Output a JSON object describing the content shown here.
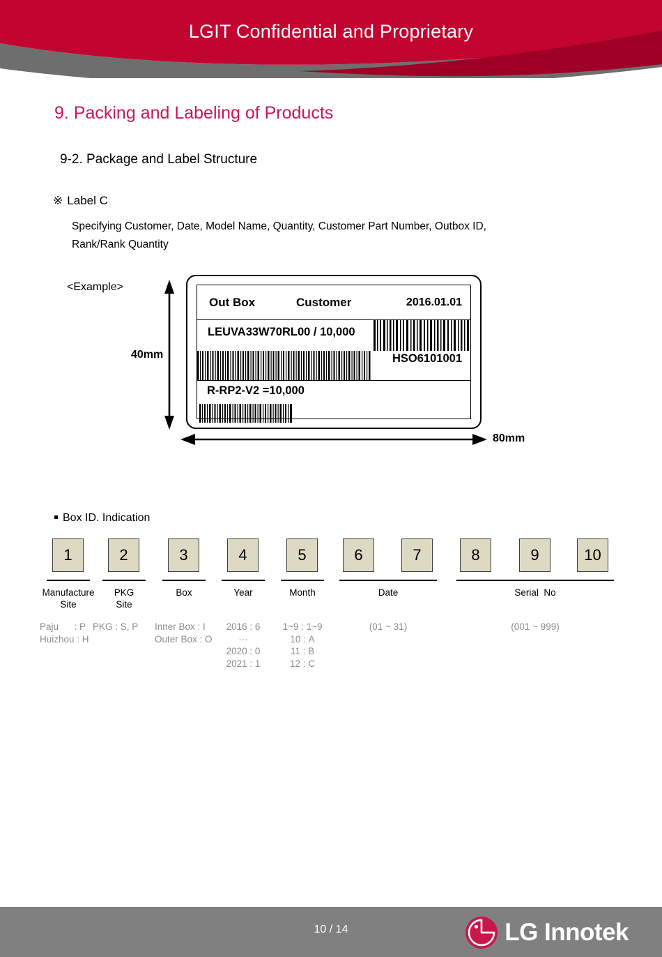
{
  "header": {
    "title": "LGIT Confidential and Proprietary",
    "band_color": "#C20430",
    "swoosh_gray": "#6E6E6E",
    "swoosh_dark_red": "#9E0026"
  },
  "slide": {
    "title": "9. Packing and Labeling of Products",
    "title_color": "#C8175A",
    "subtitle": "9-2. Package and Label Structure"
  },
  "label_c": {
    "mark": "※",
    "heading": "Label C",
    "description_line1": "Specifying Customer, Date, Model Name, Quantity, Customer Part Number, Outbox ID,",
    "description_line2": "Rank/Rank Quantity"
  },
  "example": {
    "tag": "<Example>",
    "height_dimension": "40mm",
    "width_dimension": "80mm"
  },
  "label_card": {
    "row1": {
      "out_box": "Out Box",
      "customer": "Customer",
      "date": "2016.01.01"
    },
    "row2": {
      "model_qty": "LEUVA33W70RL00 / 10,000",
      "outbox_id": "HSO6101001",
      "barcode_top_right": "barcode-outbox-id",
      "barcode_mid_left": "barcode-model-quantity"
    },
    "row3": {
      "rank_qty": "R-RP2-V2 =10,000",
      "barcode_bottom": "barcode-rank-quantity"
    }
  },
  "box_id": {
    "heading": "Box ID. Indication",
    "digits": [
      "1",
      "2",
      "3",
      "4",
      "5",
      "6",
      "7",
      "8",
      "9",
      "10"
    ],
    "groups": [
      {
        "label": "Manufacture\nSite",
        "detail": "Paju      : P\nHuizhou : H"
      },
      {
        "label": "PKG\nSite",
        "detail": "PKG : S, P"
      },
      {
        "label": "Box",
        "detail": "Inner Box : I\nOuter Box : O"
      },
      {
        "label": "Year",
        "detail": "2016 : 6\n···\n2020 : 0\n2021 : 1"
      },
      {
        "label": "Month",
        "detail": "1~9 : 1~9\n10 : A\n11 : B\n12 : C"
      },
      {
        "label": "Date",
        "detail": "(01 ~ 31)"
      },
      {
        "label": "Serial  No",
        "detail": "(001 ~ 999)"
      }
    ]
  },
  "footer": {
    "page": "10 / 14",
    "brand": "LG Innotek",
    "bar_color": "#808080",
    "logo_color": "#C8174B"
  }
}
